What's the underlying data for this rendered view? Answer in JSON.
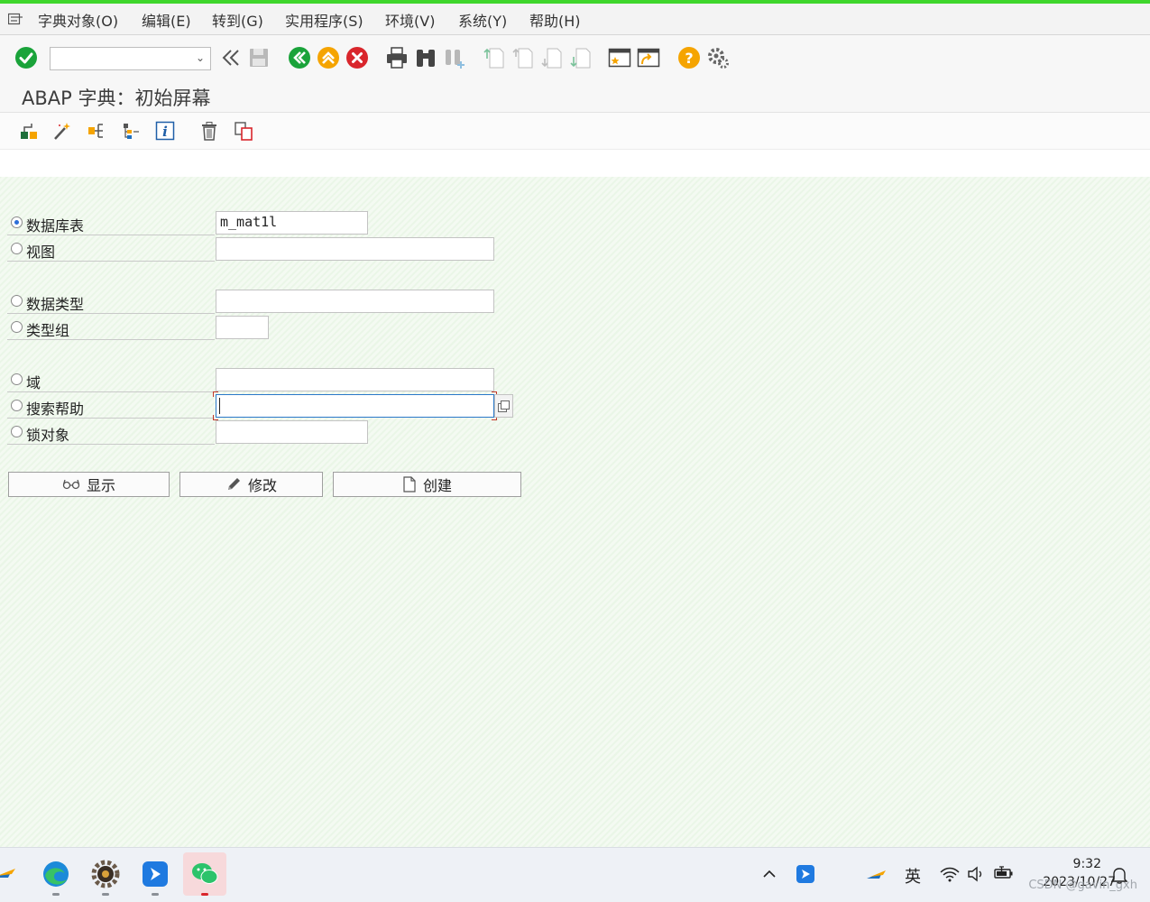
{
  "menu": {
    "items": [
      "字典对象(O)",
      "编辑(E)",
      "转到(G)",
      "实用程序(S)",
      "环境(V)",
      "系统(Y)",
      "帮助(H)"
    ]
  },
  "toolbar": {
    "command_field_value": ""
  },
  "screen": {
    "title": "ABAP 字典：初始屏幕"
  },
  "form": {
    "options": [
      {
        "label": "数据库表",
        "value": "m_mat1l",
        "selected": true
      },
      {
        "label": "视图",
        "value": "",
        "selected": false
      },
      {
        "label": "数据类型",
        "value": "",
        "selected": false
      },
      {
        "label": "类型组",
        "value": "",
        "selected": false
      },
      {
        "label": "域",
        "value": "",
        "selected": false
      },
      {
        "label": "搜索帮助",
        "value": "",
        "selected": false
      },
      {
        "label": "锁对象",
        "value": "",
        "selected": false
      }
    ]
  },
  "buttons": {
    "display": "显示",
    "change": "修改",
    "create": "创建"
  },
  "taskbar": {
    "ime": "英",
    "time": "9:32",
    "date": "2023/10/27",
    "watermark": "CSDN @gavin_gxh"
  },
  "colors": {
    "accent_green": "#3fd62c",
    "ok_green": "#1aa33a",
    "nav_orange": "#f5a400",
    "cancel_red": "#d9262c",
    "help_orange": "#f5a400",
    "focus_blue": "#2a78c9"
  }
}
